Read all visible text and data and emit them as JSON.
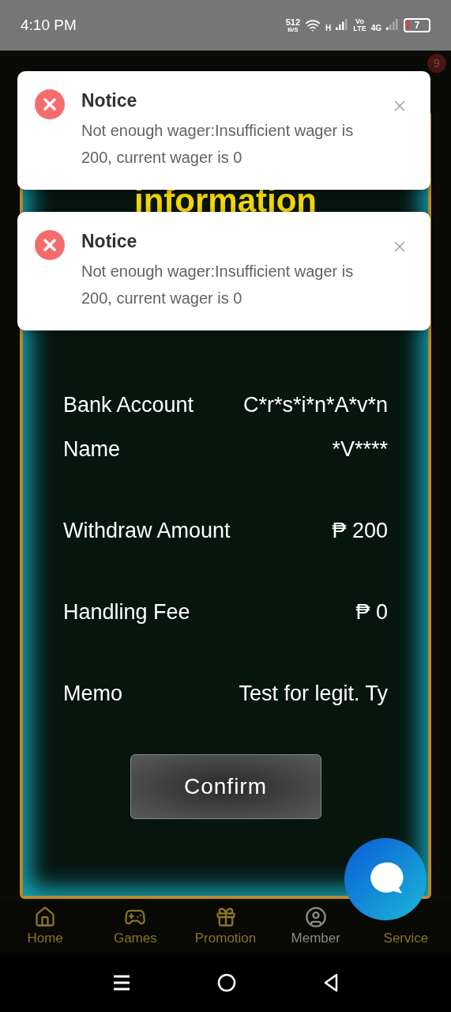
{
  "status_bar": {
    "time": "4:10 PM",
    "speed_value": "512",
    "speed_unit": "B/S",
    "network_1": "H",
    "volte_top": "Vo",
    "volte_bottom": "LTE",
    "network_2": "4G",
    "battery": "7"
  },
  "header": {
    "badge": "9"
  },
  "dialog": {
    "title": "information",
    "rows": [
      {
        "label": "Bank Account",
        "value": "C*r*s*i*n*A*v*n"
      },
      {
        "label": "Name",
        "value": "*V****"
      },
      {
        "label": "Withdraw Amount",
        "value": "₱ 200"
      },
      {
        "label": "Handling Fee",
        "value": "₱ 0"
      },
      {
        "label": "Memo",
        "value": "Test for legit. Ty"
      }
    ],
    "confirm_button": "Confirm"
  },
  "notices": [
    {
      "title": "Notice",
      "message": "Not enough wager:Insufficient wager is 200, current wager is 0"
    },
    {
      "title": "Notice",
      "message": "Not enough wager:Insufficient wager is 200, current wager is 0"
    }
  ],
  "bottom_nav": [
    {
      "kind": "home",
      "label": "Home",
      "selected": false
    },
    {
      "kind": "games",
      "label": "Games",
      "selected": false
    },
    {
      "kind": "promotion",
      "label": "Promotion",
      "selected": false
    },
    {
      "kind": "member",
      "label": "Member",
      "selected": true
    },
    {
      "kind": "service",
      "label": "Service",
      "selected": false
    }
  ]
}
